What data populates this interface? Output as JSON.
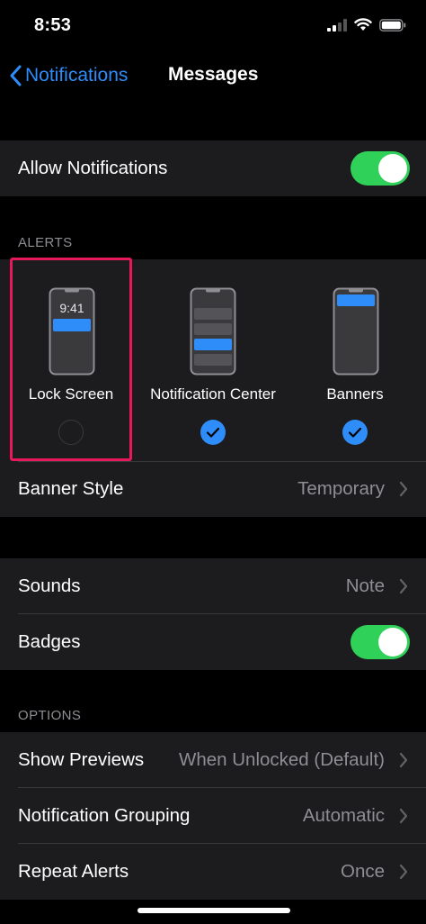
{
  "status_bar": {
    "time": "8:53"
  },
  "nav": {
    "back_label": "Notifications",
    "title": "Messages"
  },
  "allow_notifications": {
    "label": "Allow Notifications",
    "on": true
  },
  "alerts": {
    "header": "ALERTS",
    "styles": [
      {
        "label": "Lock Screen",
        "selected": false,
        "preview_time": "9:41"
      },
      {
        "label": "Notification Center",
        "selected": true
      },
      {
        "label": "Banners",
        "selected": true
      }
    ],
    "banner_style": {
      "label": "Banner Style",
      "value": "Temporary"
    }
  },
  "sounds": {
    "label": "Sounds",
    "value": "Note"
  },
  "badges": {
    "label": "Badges",
    "on": true
  },
  "options": {
    "header": "OPTIONS",
    "show_previews": {
      "label": "Show Previews",
      "value": "When Unlocked (Default)"
    },
    "notification_grouping": {
      "label": "Notification Grouping",
      "value": "Automatic"
    },
    "repeat_alerts": {
      "label": "Repeat Alerts",
      "value": "Once"
    }
  },
  "colors": {
    "accent": "#2f8dfa",
    "toggle_on": "#30d158",
    "highlight": "#e8195a",
    "cell_bg": "#1c1c1e"
  }
}
